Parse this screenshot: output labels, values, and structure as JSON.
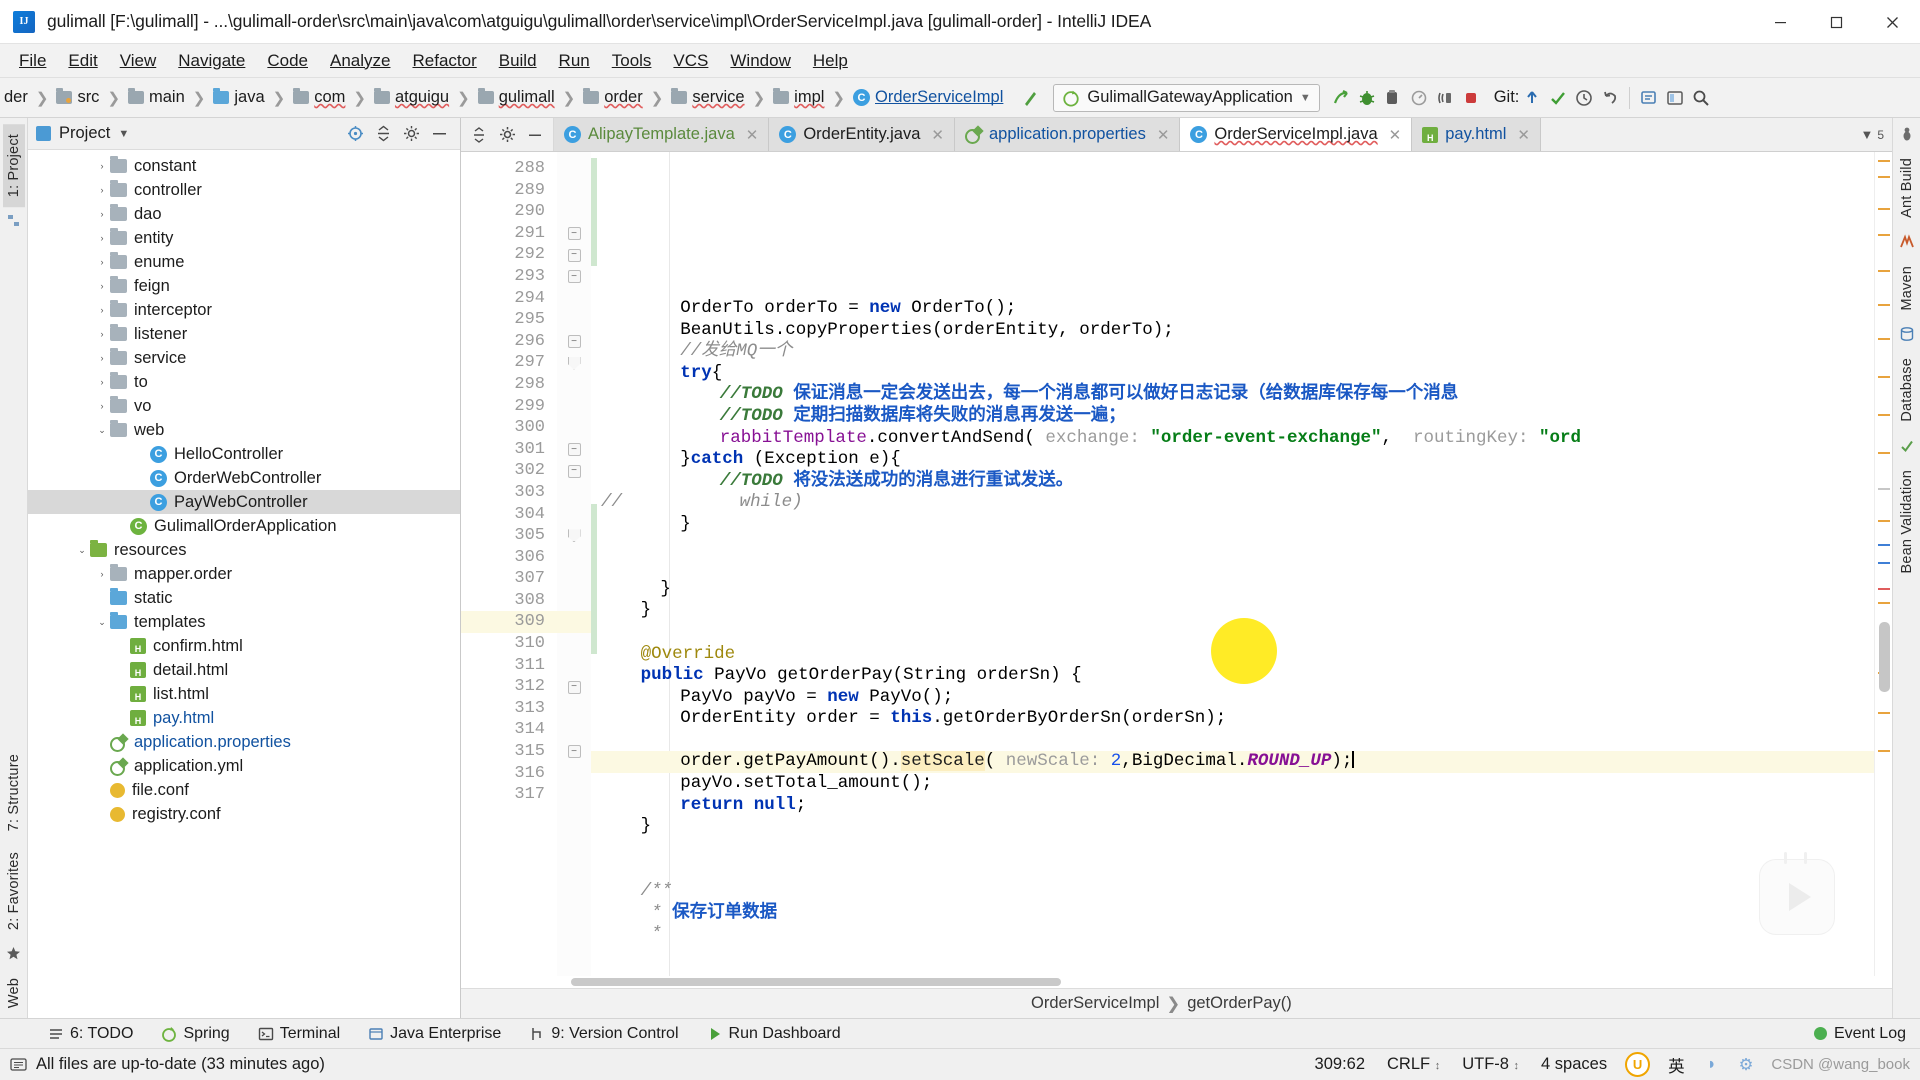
{
  "window": {
    "title": "gulimall [F:\\gulimall] - ...\\gulimall-order\\src\\main\\java\\com\\atguigu\\gulimall\\order\\service\\impl\\OrderServiceImpl.java [gulimall-order] - IntelliJ IDEA",
    "minimize": "—",
    "maximize": "□",
    "close": "✕"
  },
  "menubar": [
    "File",
    "Edit",
    "View",
    "Navigate",
    "Code",
    "Analyze",
    "Refactor",
    "Build",
    "Run",
    "Tools",
    "VCS",
    "Window",
    "Help"
  ],
  "navbar": {
    "crumbs": [
      "der",
      "src",
      "main",
      "java",
      "com",
      "atguigu",
      "gulimall",
      "order",
      "service",
      "impl",
      "OrderServiceImpl"
    ],
    "run_config": "GulimallGatewayApplication",
    "git_label": "Git:"
  },
  "left_stripe": [
    "1: Project",
    "2: Favorites",
    "Web"
  ],
  "left_stripe_struct": "7: Structure",
  "right_stripe": [
    "Ant Build",
    "Maven",
    "Database",
    "Bean Validation"
  ],
  "project_panel": {
    "title": "Project",
    "tree": [
      {
        "indent": 3,
        "arrow": "›",
        "icon": "folder",
        "label": "constant"
      },
      {
        "indent": 3,
        "arrow": "›",
        "icon": "folder",
        "label": "controller"
      },
      {
        "indent": 3,
        "arrow": "›",
        "icon": "folder",
        "label": "dao"
      },
      {
        "indent": 3,
        "arrow": "›",
        "icon": "folder",
        "label": "entity"
      },
      {
        "indent": 3,
        "arrow": "›",
        "icon": "folder",
        "label": "enume"
      },
      {
        "indent": 3,
        "arrow": "›",
        "icon": "folder",
        "label": "feign"
      },
      {
        "indent": 3,
        "arrow": "›",
        "icon": "folder",
        "label": "interceptor"
      },
      {
        "indent": 3,
        "arrow": "›",
        "icon": "folder",
        "label": "listener"
      },
      {
        "indent": 3,
        "arrow": "›",
        "icon": "folder",
        "label": "service"
      },
      {
        "indent": 3,
        "arrow": "›",
        "icon": "folder",
        "label": "to"
      },
      {
        "indent": 3,
        "arrow": "›",
        "icon": "folder",
        "label": "vo"
      },
      {
        "indent": 3,
        "arrow": "⌄",
        "icon": "folder",
        "label": "web"
      },
      {
        "indent": 5,
        "arrow": "",
        "icon": "class",
        "label": "HelloController"
      },
      {
        "indent": 5,
        "arrow": "",
        "icon": "class",
        "label": "OrderWebController"
      },
      {
        "indent": 5,
        "arrow": "",
        "icon": "class",
        "label": "PayWebController",
        "selected": true
      },
      {
        "indent": 4,
        "arrow": "",
        "icon": "spring",
        "label": "GulimallOrderApplication"
      },
      {
        "indent": 2,
        "arrow": "⌄",
        "icon": "folder-green",
        "label": "resources"
      },
      {
        "indent": 3,
        "arrow": "›",
        "icon": "folder",
        "label": "mapper.order"
      },
      {
        "indent": 3,
        "arrow": "",
        "icon": "folder-blue",
        "label": "static"
      },
      {
        "indent": 3,
        "arrow": "⌄",
        "icon": "folder-blue",
        "label": "templates"
      },
      {
        "indent": 4,
        "arrow": "",
        "icon": "html",
        "label": "confirm.html"
      },
      {
        "indent": 4,
        "arrow": "",
        "icon": "html",
        "label": "detail.html"
      },
      {
        "indent": 4,
        "arrow": "",
        "icon": "html",
        "label": "list.html"
      },
      {
        "indent": 4,
        "arrow": "",
        "icon": "html",
        "label": "pay.html",
        "link": true
      },
      {
        "indent": 3,
        "arrow": "",
        "icon": "properties",
        "label": "application.properties",
        "link": true
      },
      {
        "indent": 3,
        "arrow": "",
        "icon": "properties",
        "label": "application.yml"
      },
      {
        "indent": 3,
        "arrow": "",
        "icon": "conf",
        "label": "file.conf"
      },
      {
        "indent": 3,
        "arrow": "",
        "icon": "conf",
        "label": "registry.conf"
      }
    ]
  },
  "tabs": [
    {
      "label": "AlipayTemplate.java",
      "icon": "java-class",
      "style": "green",
      "active": false
    },
    {
      "label": "OrderEntity.java",
      "icon": "java-class",
      "style": "plain",
      "active": false
    },
    {
      "label": "application.properties",
      "icon": "properties",
      "style": "blue",
      "active": false
    },
    {
      "label": "OrderServiceImpl.java",
      "icon": "java-class",
      "style": "plain",
      "active": true
    },
    {
      "label": "pay.html",
      "icon": "html",
      "style": "blue",
      "active": false
    }
  ],
  "editor": {
    "first_line": 288,
    "lines": [
      {
        "n": 288,
        "indent": 8,
        "tokens": [
          {
            "c": "t",
            "v": "OrderTo orderTo = "
          },
          {
            "c": "k",
            "v": "new"
          },
          {
            "c": "t",
            "v": " OrderTo();"
          }
        ]
      },
      {
        "n": 289,
        "indent": 8,
        "tokens": [
          {
            "c": "t",
            "v": "BeanUtils."
          },
          {
            "c": "mcall",
            "v": "copyProperties"
          },
          {
            "c": "t",
            "v": "(orderEntity, orderTo);"
          }
        ]
      },
      {
        "n": 290,
        "indent": 8,
        "tokens": [
          {
            "c": "cm",
            "v": "//发给MQ一个"
          }
        ]
      },
      {
        "n": 291,
        "indent": 8,
        "fold": "box",
        "tokens": [
          {
            "c": "k",
            "v": "try"
          },
          {
            "c": "t",
            "v": "{"
          }
        ]
      },
      {
        "n": 292,
        "indent": 12,
        "fold": "box",
        "tokens": [
          {
            "c": "todo",
            "v": "//TODO "
          },
          {
            "c": "todotxt",
            "v": "保证消息一定会发送出去，每一个消息都可以做好日志记录（给数据库保存每一个消息"
          }
        ]
      },
      {
        "n": 293,
        "indent": 12,
        "fold": "box",
        "tokens": [
          {
            "c": "todo",
            "v": "//TODO "
          },
          {
            "c": "todotxt",
            "v": "定期扫描数据库将失败的消息再发送一遍；"
          }
        ]
      },
      {
        "n": 294,
        "indent": 12,
        "tokens": [
          {
            "c": "fld",
            "v": "rabbitTemplate"
          },
          {
            "c": "t",
            "v": "."
          },
          {
            "c": "mcall",
            "v": "convertAndSend"
          },
          {
            "c": "t",
            "v": "( "
          },
          {
            "c": "hint",
            "v": "exchange:"
          },
          {
            "c": "t",
            "v": " "
          },
          {
            "c": "s",
            "v": "\"order-event-exchange\""
          },
          {
            "c": "t",
            "v": ",  "
          },
          {
            "c": "hint",
            "v": "routingKey:"
          },
          {
            "c": "t",
            "v": " "
          },
          {
            "c": "s",
            "v": "\"ord"
          }
        ]
      },
      {
        "n": 295,
        "indent": 8,
        "tokens": [
          {
            "c": "t",
            "v": "}"
          },
          {
            "c": "k",
            "v": "catch"
          },
          {
            "c": "t",
            "v": " (Exception e){"
          }
        ]
      },
      {
        "n": 296,
        "indent": 12,
        "fold": "box",
        "tokens": [
          {
            "c": "todo",
            "v": "//TODO "
          },
          {
            "c": "todotxt",
            "v": "将没法送成功的消息进行重试发送。"
          }
        ]
      },
      {
        "n": 297,
        "indent": 14,
        "fold": "tip",
        "prefix": "//",
        "tokens": [
          {
            "c": "cm",
            "v": "while)"
          }
        ]
      },
      {
        "n": 298,
        "indent": 8,
        "tokens": [
          {
            "c": "t",
            "v": "}"
          }
        ]
      },
      {
        "n": 299,
        "indent": 0,
        "tokens": []
      },
      {
        "n": 300,
        "indent": 0,
        "tokens": []
      },
      {
        "n": 301,
        "indent": 6,
        "fold": "box",
        "tokens": [
          {
            "c": "t",
            "v": "}"
          }
        ]
      },
      {
        "n": 302,
        "indent": 4,
        "fold": "box",
        "tokens": [
          {
            "c": "t",
            "v": "}"
          }
        ]
      },
      {
        "n": 303,
        "indent": 0,
        "tokens": []
      },
      {
        "n": 304,
        "indent": 4,
        "tokens": [
          {
            "c": "ann",
            "v": "@Override"
          }
        ]
      },
      {
        "n": 305,
        "indent": 4,
        "fold": "tip",
        "marker": "override",
        "tokens": [
          {
            "c": "k",
            "v": "public"
          },
          {
            "c": "t",
            "v": " PayVo getOrderPay(String orderSn) {"
          }
        ]
      },
      {
        "n": 306,
        "indent": 8,
        "tokens": [
          {
            "c": "t",
            "v": "PayVo payVo = "
          },
          {
            "c": "k",
            "v": "new"
          },
          {
            "c": "t",
            "v": " PayVo();"
          }
        ]
      },
      {
        "n": 307,
        "indent": 8,
        "tokens": [
          {
            "c": "t",
            "v": "OrderEntity order = "
          },
          {
            "c": "k",
            "v": "this"
          },
          {
            "c": "t",
            "v": ".getOrderByOrderSn(orderSn);"
          }
        ]
      },
      {
        "n": 308,
        "indent": 0,
        "tokens": []
      },
      {
        "n": 309,
        "indent": 8,
        "hl": true,
        "bulb": true,
        "tokens": [
          {
            "c": "t",
            "v": "order.getPayAmount()."
          },
          {
            "c": "hl-tok",
            "v": "setScale"
          },
          {
            "c": "t",
            "v": "( "
          },
          {
            "c": "hint",
            "v": "newScale:"
          },
          {
            "c": "t",
            "v": " "
          },
          {
            "c": "num",
            "v": "2"
          },
          {
            "c": "t",
            "v": ",BigDecimal."
          },
          {
            "c": "stat",
            "v": "ROUND_UP"
          },
          {
            "c": "t",
            "v": ");"
          },
          {
            "c": "cursor",
            "v": ""
          }
        ]
      },
      {
        "n": 310,
        "indent": 8,
        "tokens": [
          {
            "c": "t",
            "v": "payVo.setTotal_amount();"
          }
        ]
      },
      {
        "n": 311,
        "indent": 8,
        "tokens": [
          {
            "c": "k",
            "v": "return"
          },
          {
            "c": "t",
            "v": " "
          },
          {
            "c": "k",
            "v": "null"
          },
          {
            "c": "t",
            "v": ";"
          }
        ]
      },
      {
        "n": 312,
        "indent": 4,
        "fold": "box",
        "tokens": [
          {
            "c": "t",
            "v": "}"
          }
        ]
      },
      {
        "n": 313,
        "indent": 0,
        "tokens": []
      },
      {
        "n": 314,
        "indent": 0,
        "tokens": []
      },
      {
        "n": 315,
        "indent": 4,
        "fold": "box",
        "tokens": [
          {
            "c": "cm",
            "v": "/**"
          }
        ]
      },
      {
        "n": 316,
        "indent": 4,
        "tokens": [
          {
            "c": "cm",
            "v": " * "
          },
          {
            "c": "todotxt",
            "v": "保存订单数据"
          }
        ]
      },
      {
        "n": 317,
        "indent": 4,
        "tokens": [
          {
            "c": "cm",
            "v": " *"
          }
        ]
      }
    ],
    "breadcrumb": [
      "OrderServiceImpl",
      "getOrderPay()"
    ]
  },
  "bottom_bar": {
    "items": [
      {
        "label": "6: TODO",
        "icon": "todo-list-icon"
      },
      {
        "label": "Spring",
        "icon": "spring-icon"
      },
      {
        "label": "Terminal",
        "icon": "terminal-icon"
      },
      {
        "label": "Java Enterprise",
        "icon": "java-ee-icon"
      },
      {
        "label": "9: Version Control",
        "icon": "version-control-icon"
      },
      {
        "label": "Run Dashboard",
        "icon": "run-dashboard-icon"
      }
    ],
    "event_log": "Event Log"
  },
  "statusbar": {
    "message": "All files are up-to-date (33 minutes ago)",
    "caret": "309:62",
    "line_sep": "CRLF",
    "encoding": "UTF-8",
    "indent": "4 spaces",
    "ime": "英",
    "watermark": "CSDN @wang_book"
  },
  "colors": {
    "accent_blue": "#3c9fe0",
    "keyword": "#0033b3",
    "string": "#067d17",
    "comment": "#8c8c8c",
    "todo_text": "#1a58c4",
    "highlight_row": "#fcf9e2",
    "spot": "#ffe800"
  }
}
